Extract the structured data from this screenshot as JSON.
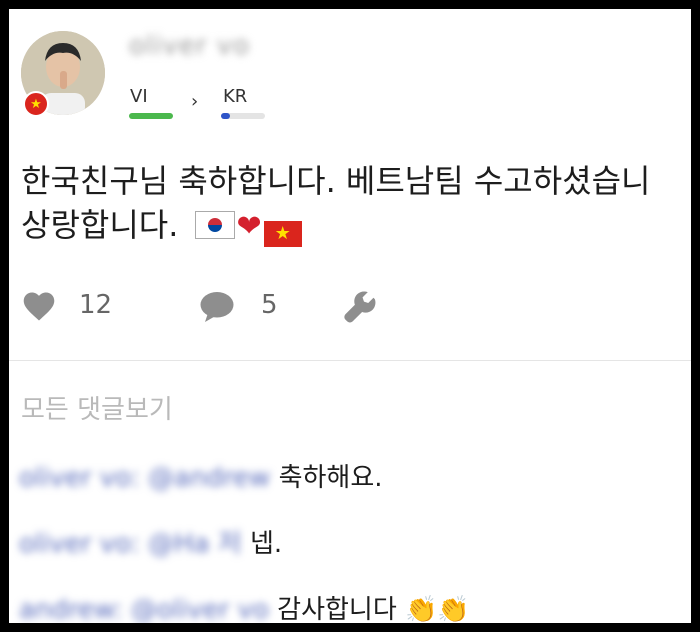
{
  "post": {
    "author": "oliver vo",
    "lang_from": "VI",
    "lang_to": "KR",
    "lang_from_progress": 1.0,
    "lang_to_progress": 0.2,
    "country_flag_icon": "vietnam-flag-icon",
    "text_line1": "한국친구님 축하합니다. 베트남팀 수고하셨습니",
    "text_line2": "상랑합니다.",
    "emojis": [
      "korea-flag-icon",
      "red-heart-icon",
      "vietnam-flag-icon"
    ]
  },
  "actions": {
    "likes": "12",
    "comments": "5"
  },
  "comments_section": {
    "view_all_label": "모든 댓글보기",
    "items": [
      {
        "author_mention": "oliver vo: @andrew",
        "text": "축하해요."
      },
      {
        "author_mention": "oliver vo: @Ha 저",
        "text": "넵."
      },
      {
        "author_mention": "andrew: @oliver vo",
        "text": "감사합니다",
        "emojis": [
          "clapping-hands-icon",
          "clapping-hands-icon"
        ]
      }
    ]
  },
  "colors": {
    "progress_green": "#4bb84d",
    "progress_blue": "#2f55c9",
    "heart_red": "#d4202e",
    "vietnam_red": "#da251d"
  }
}
